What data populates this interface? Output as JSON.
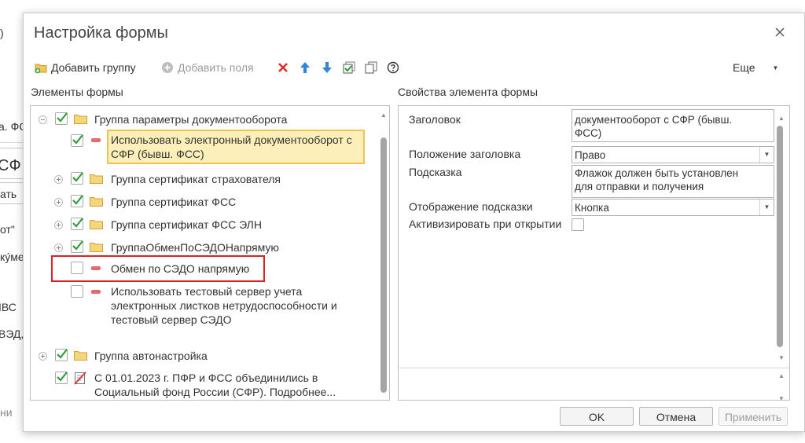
{
  "background": {
    "fragments": [
      ")",
      "а. ФС",
      "СФ",
      "ать",
      "от\"",
      "ку́ме",
      "ІВС",
      "ВЭД,",
      "ни"
    ]
  },
  "dialog": {
    "title": "Настройка формы",
    "toolbar": {
      "add_group": "Добавить группу",
      "add_field": "Добавить поля",
      "more": "Еще"
    },
    "left_title": "Элементы формы",
    "right_title": "Свойства элемента формы",
    "tree": [
      {
        "label": "Группа параметры документооборота",
        "checked": true,
        "type": "group",
        "expander": "minus"
      },
      {
        "label": [
          "Использовать электронный документооборот с",
          "СФР (бывш. ФСС)"
        ],
        "checked": true,
        "type": "field",
        "selected": true
      },
      {
        "label": "Группа сертификат страхователя",
        "checked": true,
        "type": "group",
        "expander": "plus"
      },
      {
        "label": "Группа сертификат ФСС",
        "checked": true,
        "type": "group",
        "expander": "plus"
      },
      {
        "label": "Группа сертификат ФСС ЭЛН",
        "checked": true,
        "type": "group",
        "expander": "plus"
      },
      {
        "label": "ГруппаОбменПоСЭДОНапрямую",
        "checked": true,
        "type": "group",
        "expander": "plus"
      },
      {
        "label": "Обмен по СЭДО напрямую",
        "checked": false,
        "type": "field",
        "highlighted": true
      },
      {
        "label": [
          "Использовать тестовый сервер учета",
          "электронных листков нетрудоспособности и",
          "тестовый сервер СЭДО"
        ],
        "checked": false,
        "type": "field"
      },
      {
        "label": "Группа автонастройка",
        "checked": true,
        "type": "group",
        "expander": "plus"
      },
      {
        "label": [
          "С 01.01.2023 г. ПФР и ФСС объединились в",
          "Социальный фонд России (СФР). Подробнее..."
        ],
        "checked": true,
        "type": "decoration"
      }
    ],
    "properties": {
      "title_label": "Заголовок",
      "title_value": [
        "документооборот с СФР (бывш.",
        "ФСС)"
      ],
      "title_position_label": "Положение заголовка",
      "title_position_value": "Право",
      "hint_label": "Подсказка",
      "hint_value": [
        "Флажок должен быть установлен",
        "для отправки и получения"
      ],
      "hint_display_label": "Отображение подсказки",
      "hint_display_value": "Кнопка",
      "activate_label": "Активизировать при открытии"
    },
    "buttons": {
      "ok": "OK",
      "cancel": "Отмена",
      "apply": "Применить"
    },
    "colors": {
      "selection_fill": "#fcefb9",
      "selection_border": "#f2c14e",
      "highlight_border": "#e02020",
      "check_green": "#2e9e3a",
      "folder_yellow": "#f3c75a"
    }
  }
}
